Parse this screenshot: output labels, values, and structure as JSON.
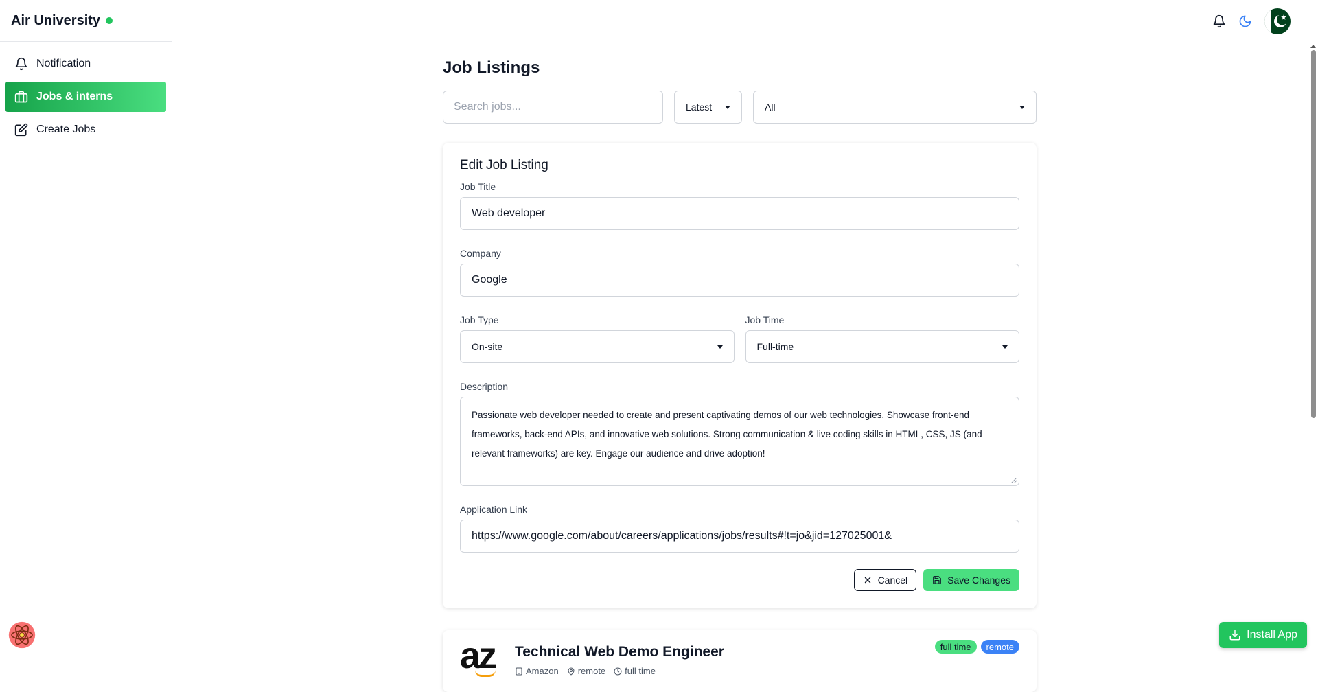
{
  "brand": {
    "name": "Air University",
    "status_color": "#22c55e"
  },
  "sidebar": {
    "items": [
      {
        "label": "Notification",
        "icon": "bell-icon"
      },
      {
        "label": "Jobs & interns",
        "icon": "briefcase-icon",
        "active": true
      },
      {
        "label": "Create Jobs",
        "icon": "edit-icon"
      }
    ]
  },
  "header": {
    "icons": [
      "bell-icon",
      "moon-icon",
      "avatar"
    ]
  },
  "main": {
    "title": "Job Listings",
    "search_placeholder": "Search jobs...",
    "sort_value": "Latest",
    "filter_value": "All"
  },
  "edit_form": {
    "heading": "Edit Job Listing",
    "job_title_label": "Job Title",
    "job_title_value": "Web developer",
    "company_label": "Company",
    "company_value": "Google",
    "job_type_label": "Job Type",
    "job_type_value": "On-site",
    "job_time_label": "Job Time",
    "job_time_value": "Full-time",
    "description_label": "Description",
    "description_value": "Passionate web developer needed to create and present captivating demos of our web technologies. Showcase front-end frameworks, back-end APIs, and innovative web solutions. Strong communication & live coding skills in HTML, CSS, JS (and relevant frameworks) are key. Engage our audience and drive adoption!",
    "link_label": "Application Link",
    "link_value": "https://www.google.com/about/careers/applications/jobs/results#!t=jo&jid=127025001&",
    "cancel_label": "Cancel",
    "save_label": "Save Changes"
  },
  "job_card": {
    "logo_text": "az",
    "title": "Technical Web Demo Engineer",
    "company": "Amazon",
    "location": "remote",
    "time": "full time",
    "tags": [
      "full time",
      "remote"
    ]
  },
  "install_label": "Install App",
  "colors": {
    "accent": "#22c55e",
    "accent_light": "#4ade80",
    "tag_blue": "#3b82f6"
  }
}
